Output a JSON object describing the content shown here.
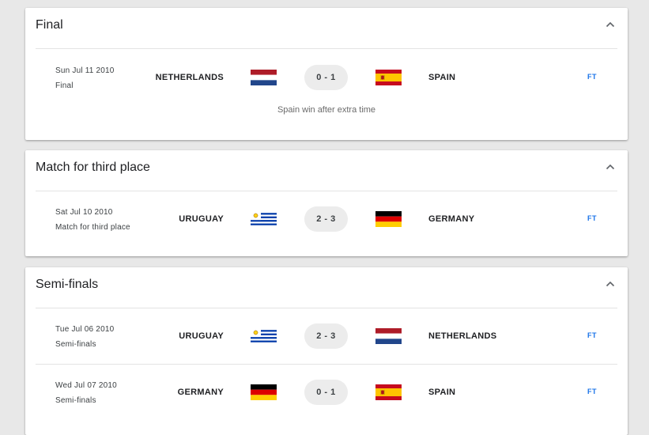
{
  "sections": [
    {
      "title": "Final",
      "matches": [
        {
          "date": "Sun Jul 11 2010",
          "stage": "Final",
          "home": "NETHERLANDS",
          "home_flag": "netherlands-flag",
          "score": "0 - 1",
          "away": "SPAIN",
          "away_flag": "spain-flag",
          "status": "FT"
        }
      ],
      "note": "Spain win after extra time"
    },
    {
      "title": "Match for third place",
      "matches": [
        {
          "date": "Sat Jul 10 2010",
          "stage": "Match for third place",
          "home": "URUGUAY",
          "home_flag": "uruguay-flag",
          "score": "2 - 3",
          "away": "GERMANY",
          "away_flag": "germany-flag",
          "status": "FT"
        }
      ]
    },
    {
      "title": "Semi-finals",
      "matches": [
        {
          "date": "Tue Jul 06 2010",
          "stage": "Semi-finals",
          "home": "URUGUAY",
          "home_flag": "uruguay-flag",
          "score": "2 - 3",
          "away": "NETHERLANDS",
          "away_flag": "netherlands-flag",
          "status": "FT"
        },
        {
          "date": "Wed Jul 07 2010",
          "stage": "Semi-finals",
          "home": "GERMANY",
          "home_flag": "germany-flag",
          "score": "0 - 1",
          "away": "SPAIN",
          "away_flag": "spain-flag",
          "status": "FT"
        }
      ]
    }
  ],
  "icons": {
    "collapse": "chevron-up-icon"
  },
  "colors": {
    "status": "#1a73e8",
    "score_pill": "#ececec",
    "background": "#e8e8e8"
  }
}
